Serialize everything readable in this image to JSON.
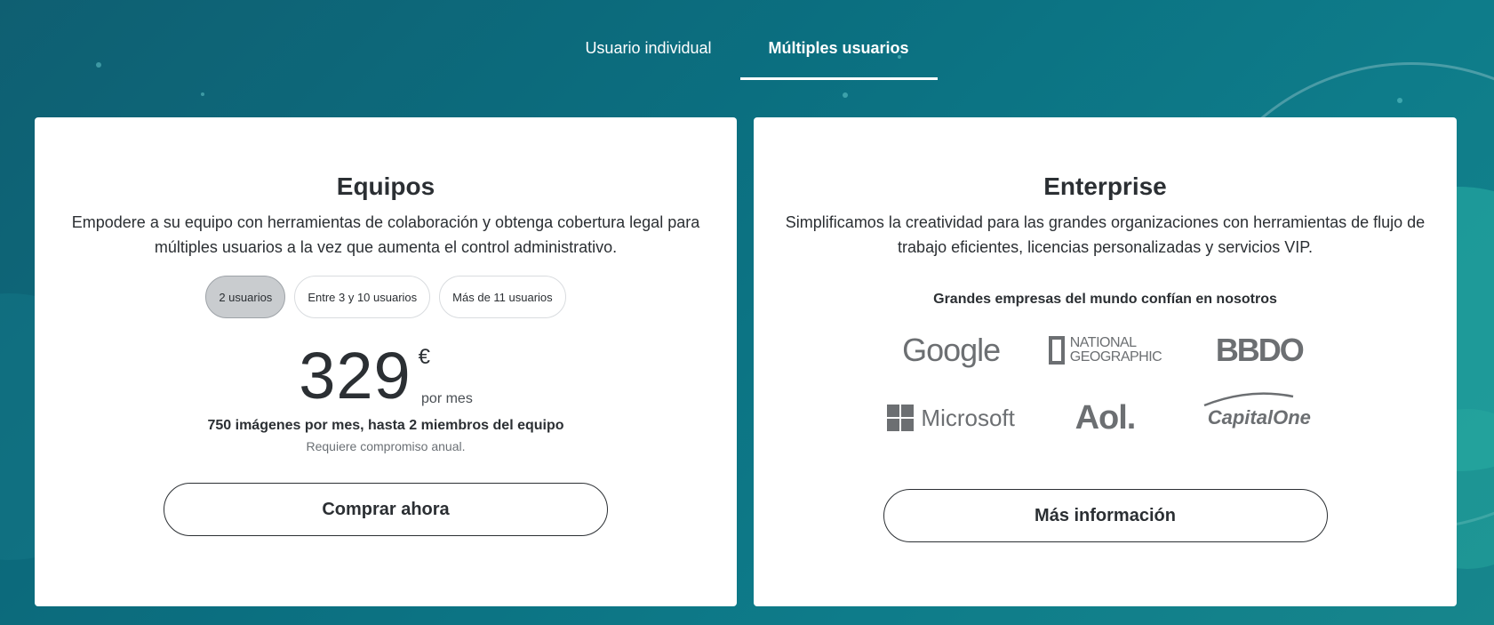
{
  "tabs": [
    {
      "label": "Usuario individual",
      "active": false
    },
    {
      "label": "Múltiples usuarios",
      "active": true
    }
  ],
  "teams_card": {
    "title": "Equipos",
    "description": "Empodere a su equipo con herramientas de colaboración y obtenga cobertura legal para múltiples usuarios a la vez que aumenta el control administrativo.",
    "user_options": [
      {
        "label": "2 usuarios",
        "selected": true
      },
      {
        "label": "Entre 3 y 10 usuarios",
        "selected": false
      },
      {
        "label": "Más de 11 usuarios",
        "selected": false
      }
    ],
    "price": "329",
    "currency": "€",
    "period": "por mes",
    "quota": "750 imágenes por mes, hasta 2 miembros del equipo",
    "note": "Requiere compromiso anual.",
    "cta_label": "Comprar ahora"
  },
  "enterprise_card": {
    "title": "Enterprise",
    "description": "Simplificamos la creatividad para las grandes organizaciones con herramientas de flujo de trabajo eficientes, licencias personalizadas y servicios VIP.",
    "trust_heading": "Grandes empresas del mundo confían en nosotros",
    "logos": {
      "google": "Google",
      "natgeo_line1": "NATIONAL",
      "natgeo_line2": "GEOGRAPHIC",
      "bbdo": "BBDO",
      "microsoft": "Microsoft",
      "aol": "Aol.",
      "capital_one": "CapitalOne"
    },
    "cta_label": "Más información"
  },
  "colors": {
    "background_start": "#0f5f72",
    "background_end": "#17868c",
    "card_bg": "#ffffff",
    "text_dark": "#2b2f33",
    "logo_gray": "#6c6f72",
    "selected_pill_bg": "#c9cccf"
  }
}
